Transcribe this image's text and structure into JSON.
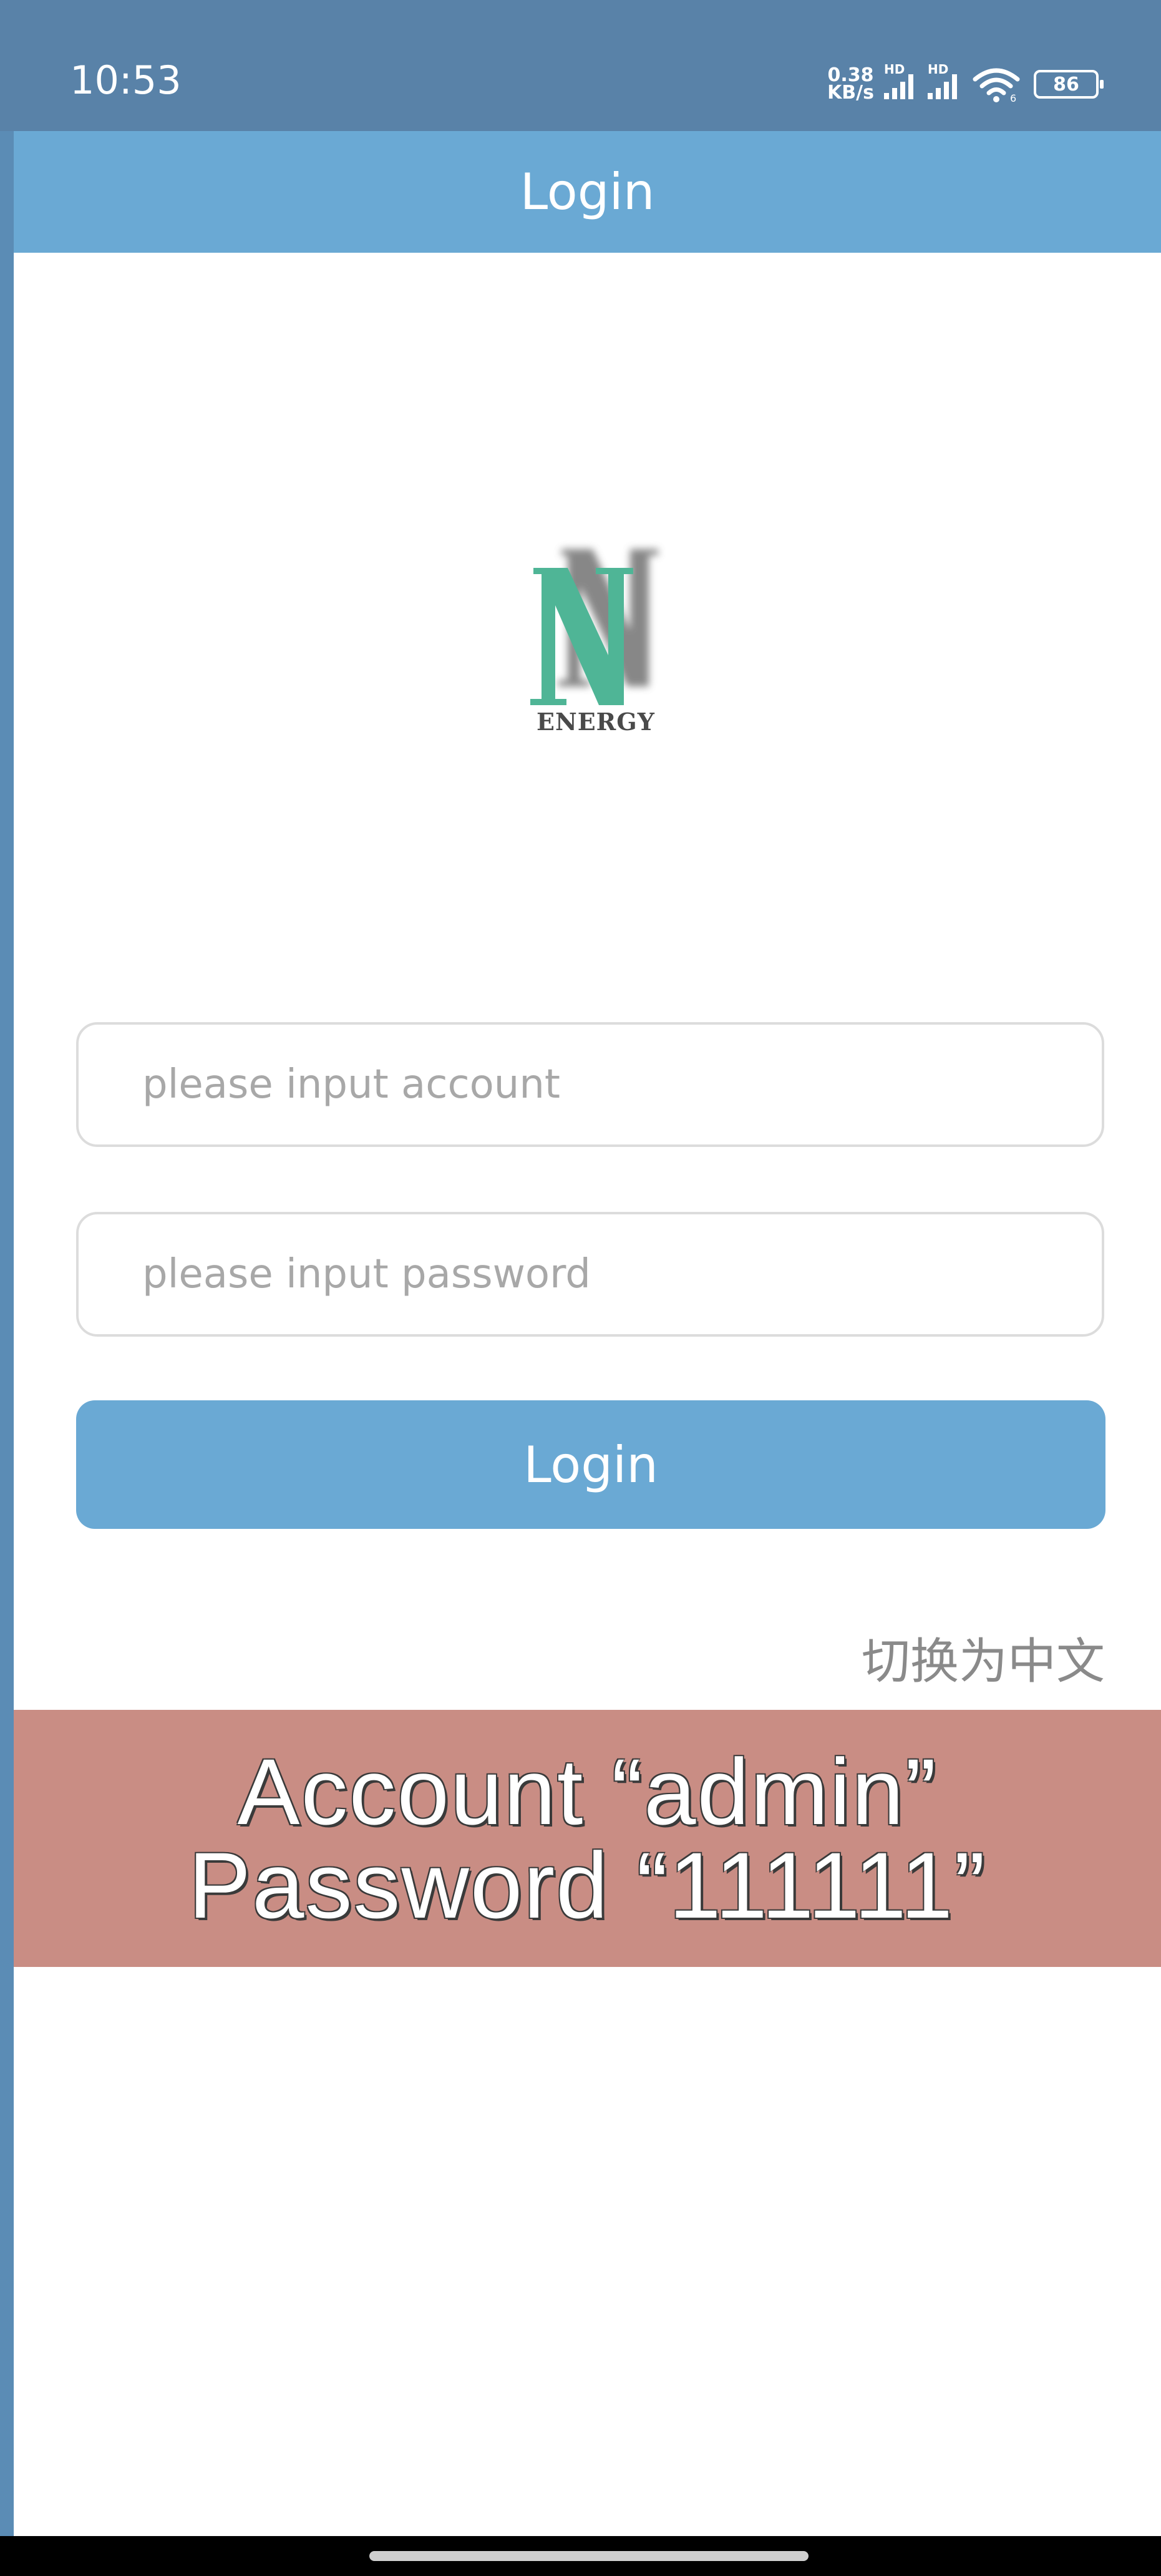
{
  "status_bar": {
    "time": "10:53",
    "net_speed_value": "0.38",
    "net_speed_unit": "KB/s",
    "signal_1_label": "HD",
    "signal_2_label": "HD",
    "wifi_label": "6",
    "battery": "86"
  },
  "header": {
    "title": "Login"
  },
  "logo": {
    "letter": "N",
    "text": "ENERGY",
    "accent_color": "#4fb596"
  },
  "form": {
    "account_placeholder": "please input account",
    "account_value": "",
    "password_placeholder": "please input password",
    "password_value": "",
    "login_button_label": "Login",
    "language_switch_label": "切换为中文"
  },
  "overlay": {
    "line1": "Account “admin”",
    "line2": "Password “111111”"
  },
  "colors": {
    "status_bar": "#5982a8",
    "app_bar": "#6aa9d4",
    "button": "#6aa9d4",
    "overlay": "#c98d84"
  },
  "icons": [
    "signal-icon",
    "wifi-icon",
    "battery-icon"
  ]
}
